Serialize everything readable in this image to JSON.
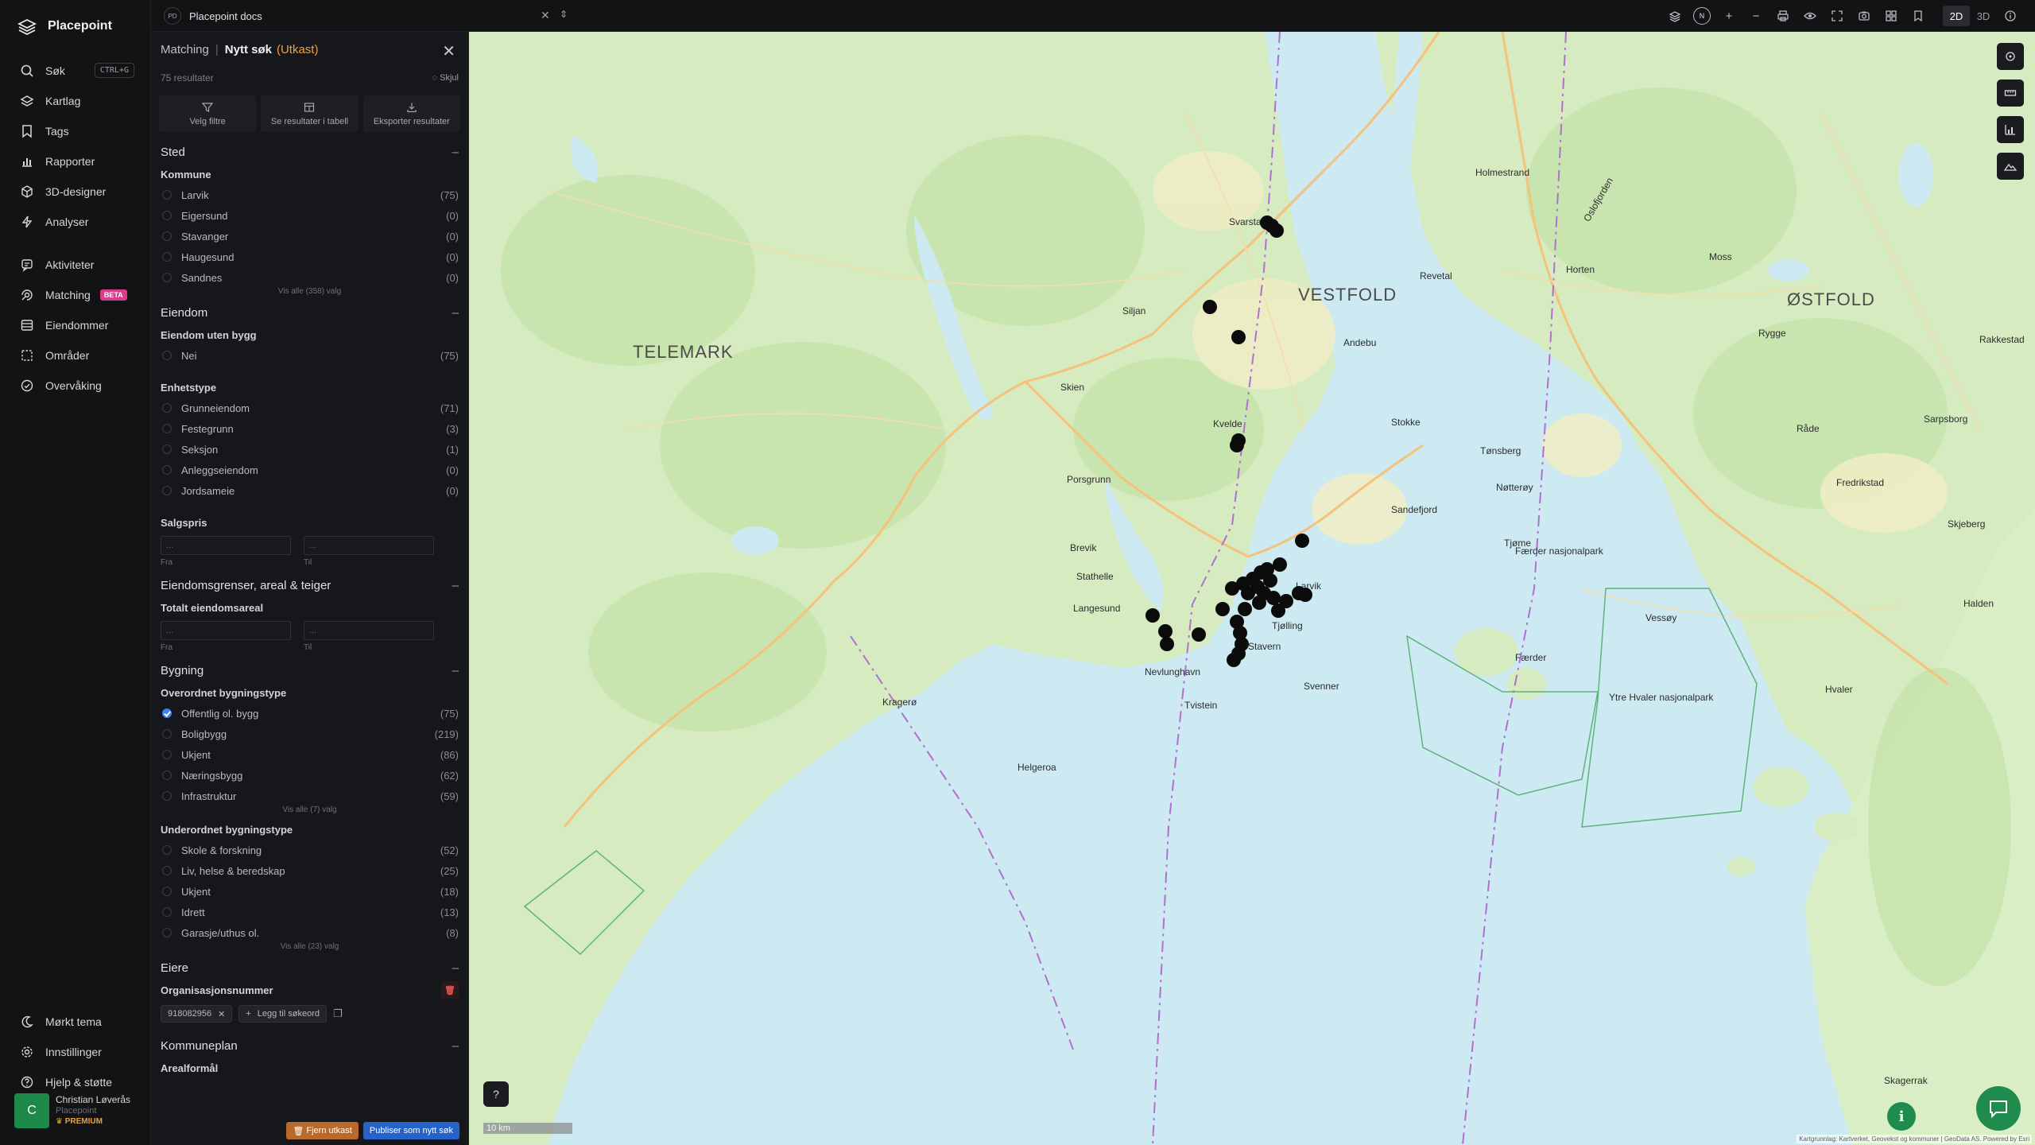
{
  "brand": {
    "name": "Placepoint"
  },
  "nav": {
    "items": [
      {
        "label": "Søk",
        "icon": "search-icon",
        "shortcut": "CTRL+G"
      },
      {
        "label": "Kartlag",
        "icon": "layers-icon"
      },
      {
        "label": "Tags",
        "icon": "bookmark-icon"
      },
      {
        "label": "Rapporter",
        "icon": "bar-chart-icon"
      },
      {
        "label": "3D-designer",
        "icon": "cube-icon"
      },
      {
        "label": "Analyser",
        "icon": "bolt-icon"
      }
    ],
    "items2": [
      {
        "label": "Aktiviteter",
        "icon": "activity-icon"
      },
      {
        "label": "Matching",
        "icon": "target-icon",
        "badge": "BETA"
      },
      {
        "label": "Eiendommer",
        "icon": "list-icon"
      },
      {
        "label": "Områder",
        "icon": "area-icon"
      },
      {
        "label": "Overvåking",
        "icon": "monitor-icon"
      }
    ],
    "bottom": [
      {
        "label": "Mørkt tema",
        "icon": "moon-icon"
      },
      {
        "label": "Innstillinger",
        "icon": "gear-icon"
      },
      {
        "label": "Hjelp & støtte",
        "icon": "help-icon"
      }
    ],
    "user": {
      "initial": "C",
      "name": "Christian Løverås",
      "org": "Placepoint",
      "tier": "PREMIUM"
    }
  },
  "topbar": {
    "project_badge": "PD",
    "project_name": "Placepoint docs",
    "north": "N",
    "mode_2d": "2D",
    "mode_3d": "3D"
  },
  "panel": {
    "breadcrumb_root": "Matching",
    "breadcrumb_current": "Nytt søk",
    "draft": "(Utkast)",
    "results": "75 resultater",
    "hide": "Skjul",
    "actions": [
      "Velg filtre",
      "Se resultater i tabell",
      "Eksporter resultater"
    ],
    "sted": {
      "title": "Sted",
      "kommune": {
        "title": "Kommune",
        "options": [
          {
            "label": "Larvik",
            "count": "(75)"
          },
          {
            "label": "Eigersund",
            "count": "(0)"
          },
          {
            "label": "Stavanger",
            "count": "(0)"
          },
          {
            "label": "Haugesund",
            "count": "(0)"
          },
          {
            "label": "Sandnes",
            "count": "(0)"
          }
        ],
        "show_all": "Vis alle (358) valg"
      }
    },
    "eiendom": {
      "title": "Eiendom",
      "uten_bygg": {
        "title": "Eiendom uten bygg",
        "options": [
          {
            "label": "Nei",
            "count": "(75)"
          }
        ]
      },
      "enhetstype": {
        "title": "Enhetstype",
        "options": [
          {
            "label": "Grunneiendom",
            "count": "(71)"
          },
          {
            "label": "Festegrunn",
            "count": "(3)"
          },
          {
            "label": "Seksjon",
            "count": "(1)"
          },
          {
            "label": "Anleggseiendom",
            "count": "(0)"
          },
          {
            "label": "Jordsameie",
            "count": "(0)"
          }
        ]
      },
      "salgspris": {
        "title": "Salgspris",
        "from": "Fra",
        "to": "Til",
        "placeholder": "..."
      }
    },
    "grenser": {
      "title": "Eiendomsgrenser, areal & teiger",
      "areal": {
        "title": "Totalt eiendomsareal",
        "from": "Fra",
        "to": "Til",
        "placeholder": "..."
      }
    },
    "bygning": {
      "title": "Bygning",
      "overordnet": {
        "title": "Overordnet bygningstype",
        "options": [
          {
            "label": "Offentlig ol. bygg",
            "count": "(75)"
          },
          {
            "label": "Boligbygg",
            "count": "(219)"
          },
          {
            "label": "Ukjent",
            "count": "(86)"
          },
          {
            "label": "Næringsbygg",
            "count": "(62)"
          },
          {
            "label": "Infrastruktur",
            "count": "(59)"
          }
        ],
        "show_all": "Vis alle (7) valg"
      },
      "underordnet": {
        "title": "Underordnet bygningstype",
        "options": [
          {
            "label": "Skole & forskning",
            "count": "(52)"
          },
          {
            "label": "Liv, helse & beredskap",
            "count": "(25)"
          },
          {
            "label": "Ukjent",
            "count": "(18)"
          },
          {
            "label": "Idrett",
            "count": "(13)"
          },
          {
            "label": "Garasje/uthus ol.",
            "count": "(8)"
          }
        ],
        "show_all": "Vis alle (23) valg"
      }
    },
    "eiere": {
      "title": "Eiere",
      "org_title": "Organisasjonsnummer",
      "chip": "918082956",
      "add": "Legg til søkeord"
    },
    "kommuneplan": {
      "title": "Kommuneplan",
      "sub": "Arealformål"
    },
    "footer": {
      "remove": "Fjern utkast",
      "publish": "Publiser som nytt søk"
    }
  },
  "map": {
    "regions": [
      "VESTFOLD",
      "TELEMARK",
      "ØSTFOLD"
    ],
    "places": [
      "Skien",
      "Porsgrunn",
      "Langesund",
      "Brevik",
      "Stathelle",
      "Larvik",
      "Stavern",
      "Sandefjord",
      "Tønsberg",
      "Horten",
      "Holmestrand",
      "Moss",
      "Fredrikstad",
      "Sarpsborg",
      "Halden",
      "Kragerø",
      "Helgeroa",
      "Nevlunghavn",
      "Tvistein",
      "Svenner",
      "Færder",
      "Tjøme",
      "Hvaler",
      "Kvelde",
      "Siljan",
      "Svarstad",
      "Andebu",
      "Revetal",
      "Stokke",
      "Nøtterøy",
      "Rygge",
      "Råde",
      "Skjeberg",
      "Rakkestad",
      "Færder nasjonalpark",
      "Ytre Hvaler nasjonalpark",
      "Skagerrak",
      "Oslofjorden",
      "Tjølling",
      "Vessøy"
    ],
    "scale": "10 km",
    "attribution": "Kartgrunnlag: Kartverket, Geovekst og kommuner | GeoData AS. Powered by Esri",
    "colors": {
      "water": "#cdeaf2",
      "land": "#d6ecc0",
      "roads": "#f4c27a",
      "marker": "#0b0b0b"
    }
  }
}
